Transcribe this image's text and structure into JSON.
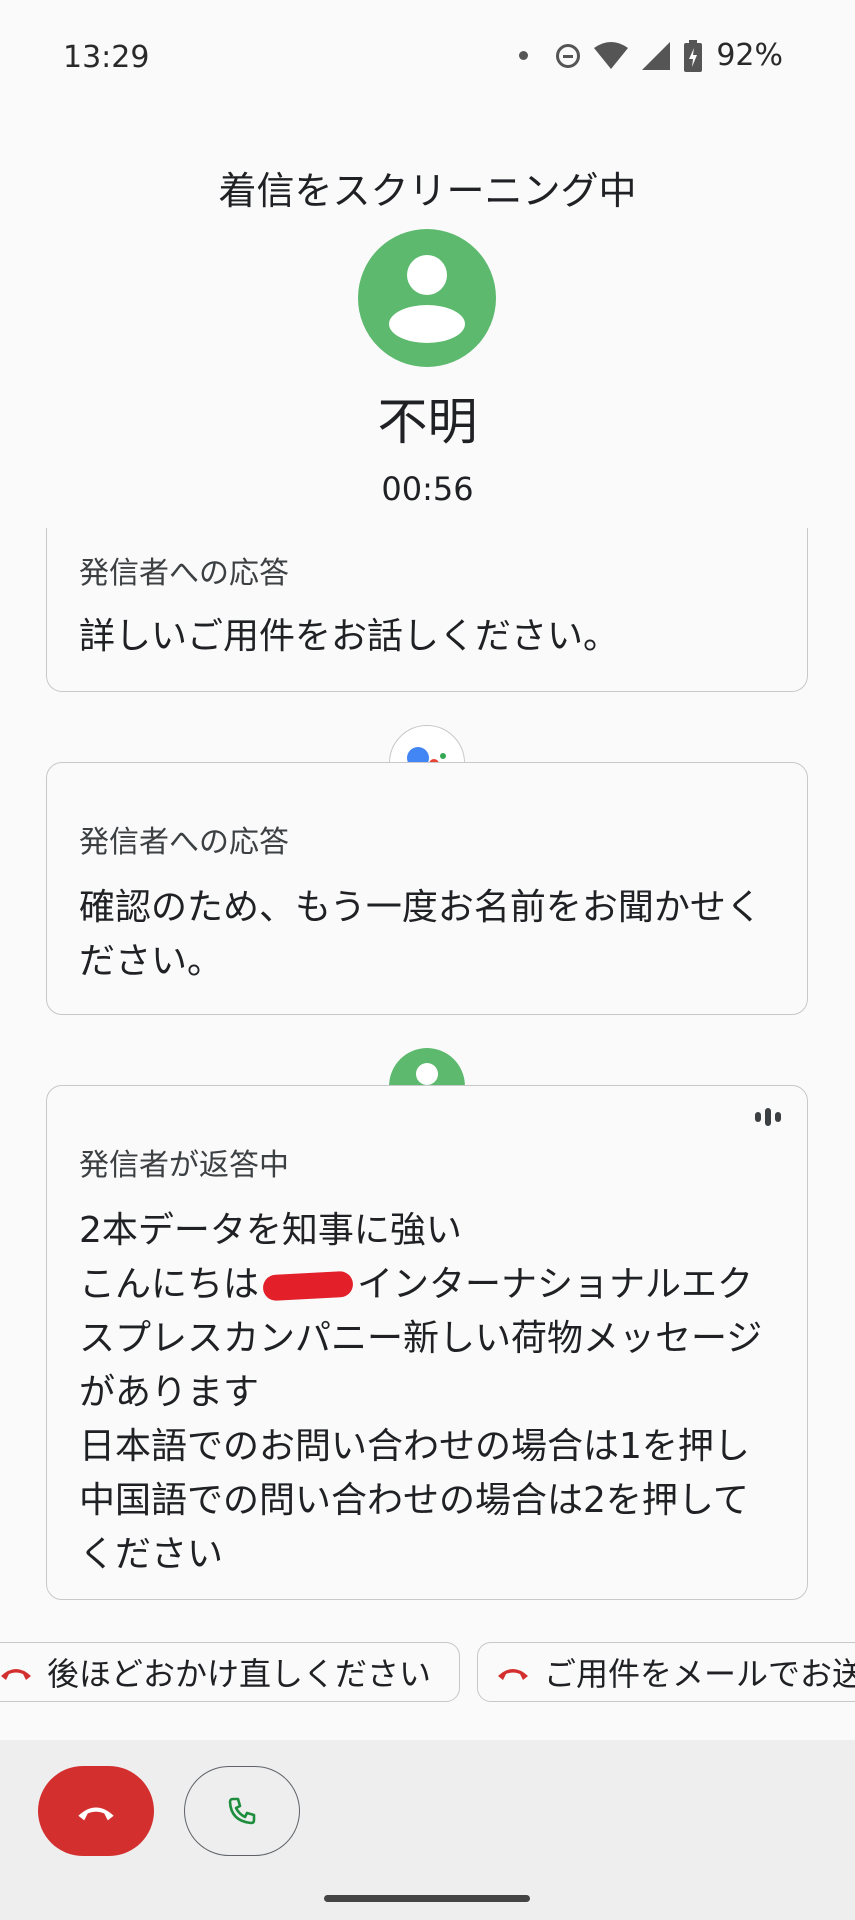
{
  "status_bar": {
    "time": "13:29",
    "battery_percent": "92%",
    "icons": [
      "notification-dot-icon",
      "do-not-disturb-icon",
      "wifi-icon",
      "cell-signal-icon",
      "battery-charging-icon"
    ]
  },
  "header": {
    "title": "着信をスクリーニング中",
    "caller_name": "不明",
    "timer": "00:56"
  },
  "transcript": [
    {
      "label": "発信者への応答",
      "text": "詳しいご用件をお話しください。"
    },
    {
      "label": "発信者への応答",
      "text": "確認のため、もう一度お名前をお聞かせください。"
    },
    {
      "label": "発信者が返答中",
      "lines": [
        "2本データを知事に強い",
        "こんにちは",
        "インターナショナルエク",
        "スプレスカンパニー新しい荷物メッセージ",
        "があります",
        "日本語でのお問い合わせの場合は1を押し",
        "中国語での問い合わせの場合は2を押して",
        "ください"
      ]
    }
  ],
  "quick_replies": [
    "後ほどおかけ直しください",
    "ご用件をメールでお送"
  ],
  "colors": {
    "avatar_green": "#5cb96d",
    "decline_red": "#d32f2f",
    "answer_green": "#1e8e3e",
    "google_blue": "#4285f4",
    "google_red": "#ea4335",
    "google_yellow": "#fbbc04",
    "google_green": "#34a853"
  }
}
